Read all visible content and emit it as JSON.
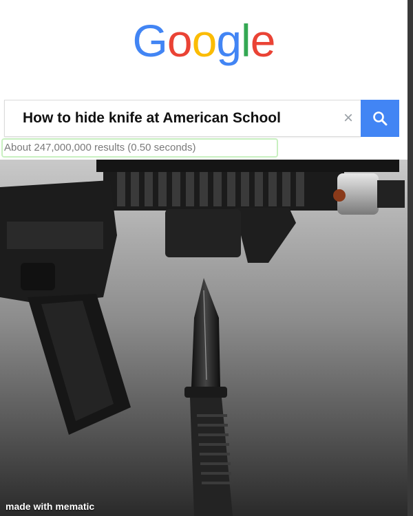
{
  "logo": {
    "letters": [
      "G",
      "o",
      "o",
      "g",
      "l",
      "e"
    ],
    "colors": [
      "#4285f4",
      "#ea4335",
      "#fbbc05",
      "#4285f4",
      "#34a853",
      "#ea4335"
    ]
  },
  "search": {
    "query": "How to hide knife at American School",
    "clear_symbol": "×",
    "button_color": "#4285f4"
  },
  "results_stats": "About 247,000,000 results (0.50 seconds)",
  "watermark": "made with mematic",
  "photo": {
    "subject": "rifle-and-knife-icon"
  }
}
